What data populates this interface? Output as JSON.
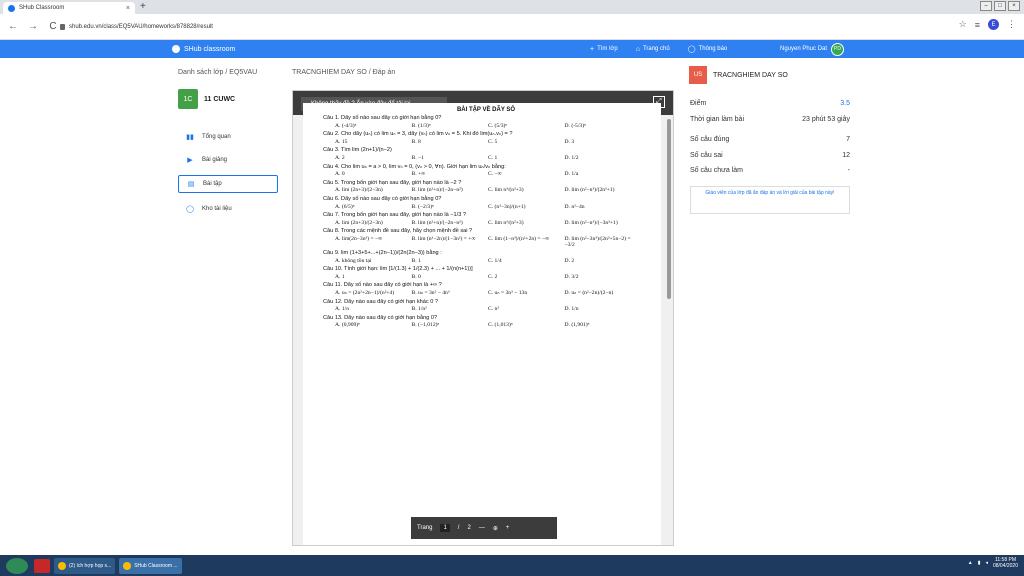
{
  "browser": {
    "tab_title": "SHub Classroom",
    "tab_close": "×",
    "new_tab": "+",
    "url": "shub.edu.vn/class/EQ5VAU/homeworks/878828/result",
    "back": "←",
    "forward": "→",
    "reload": "C",
    "star": "☆",
    "profile": "E",
    "menu": "⋮"
  },
  "app": {
    "brand": "SHub classroom",
    "nav": [
      {
        "label": "Tìm lớp",
        "icon": "+"
      },
      {
        "label": "Trang chủ",
        "icon": "⌂"
      },
      {
        "label": "Thông báo",
        "icon": "◯"
      }
    ],
    "user_name": "Nguyen Phuc Dat",
    "user_initials": "PD"
  },
  "breadcrumb_left": "Danh sách lớp / EQ5VAU",
  "breadcrumb_right": "TRACNGHIEM DAY SO / Đáp án",
  "class": {
    "code": "1C",
    "name": "11 CUWC"
  },
  "sidebar": [
    {
      "label": "Tổng quan",
      "icon": "▮▮"
    },
    {
      "label": "Bài giảng",
      "icon": "▶"
    },
    {
      "label": "Bài tập",
      "icon": "▤"
    },
    {
      "label": "Kho tài liệu",
      "icon": "◯"
    }
  ],
  "viewer": {
    "no_download": "Không thấy đề ? Ấn vào đây để tải lại",
    "open_icon": "⤢",
    "title": "BÀI TẬP VỀ DÃY SỐ",
    "pager_label": "Trang",
    "page_current": "1",
    "page_sep": "/",
    "page_total": "2",
    "zoom_out": "—",
    "zoom_icon": "⊕",
    "zoom_in": "+"
  },
  "doc": {
    "q1": "Câu 1. Dãy số nào sau đây có giới hạn bằng 0?",
    "q1_opts": [
      "A. (-4/3)ⁿ",
      "B. (1/3)ⁿ",
      "C. (5/3)ⁿ",
      "D. (-5/3)ⁿ"
    ],
    "q2": "Câu 2. Cho dãy (uₙ) có lim uₙ = 3, dãy (vₙ) có lim vₙ = 5. Khi đó lim(uₙ.vₙ) = ?",
    "q2_opts": [
      "A. 15",
      "B. 8",
      "C. 5",
      "D. 3"
    ],
    "q3": "Câu 3. Tìm lim (2n+1)/(n−2)",
    "q3_opts": [
      "A. 2",
      "B. −1",
      "C. 1",
      "D. 1/2"
    ],
    "q4": "Câu 4. Cho lim uₙ = a > 0, lim vₙ = 0, (vₙ > 0, ∀n). Giới hạn lim uₙ/vₙ bằng:",
    "q4_opts": [
      "A. 0",
      "B. +∞",
      "C. −∞",
      "D. 1/a"
    ],
    "q5": "Câu 5. Trong bốn giới hạn sau đây, giới hạn nào là −2 ?",
    "q5_opts": [
      "A. lim (2n+3)/(2−3n)",
      "B. lim (n²+n)/(−2n−n²)",
      "C. lim n³/(n²+3)",
      "D. lim (n²−n³)/(2n³+1)"
    ],
    "q6": "Câu 6. Dãy số nào sau đây có giới hạn bằng 0?",
    "q6_opts": [
      "A. (6/5)ⁿ",
      "B. (−2/3)ⁿ",
      "C. (n³−3n)/(n+1)",
      "D. n²−4n"
    ],
    "q7": "Câu 7. Trong bốn giới hạn sau đây, giới hạn nào là −1/3 ?",
    "q7_opts": [
      "A. lim (2n+3)/(2−3n)",
      "B. lim (n²+n)/(−2n−n²)",
      "C. lim n³/(n²+3)",
      "D. lim (n²−n³)/(−3n³+1)"
    ],
    "q8": "Câu 8. Trong các mệnh đề sau đây, hãy chọn mệnh đề sai ?",
    "q8_opts": [
      "A. lim(2n−3n³) = −∞",
      "B. lim (n³−2n)/(1−3n²) = +∞",
      "C. lim (1−n³)/(n²+2n) = −∞",
      "D. lim (n²−3n³)/(2n³+5n−2) = −3/2"
    ],
    "q9": "Câu 9. lim (1+3+5+...+(2n−1))/(2n(2n−3)) bằng :",
    "q9_opts": [
      "A. không tồn tại",
      "B. 1",
      "C. 1/4",
      "D. 2"
    ],
    "q10": "Câu 10. Tính giới hạn: lim [1/(1.3) + 1/(2.3) + ... + 1/(n(n+1))]",
    "q10_opts": [
      "A. 1",
      "B. 0",
      "C. 2",
      "D. 3/2"
    ],
    "q11": "Câu 11. Dãy số nào sau đây có giới hạn là +∞ ?",
    "q11_opts": [
      "A. uₙ = (2n²+2n−1)/(n²+4)",
      "B. uₙ = 3n² − 4n³",
      "C. uₙ = 3n³ − 13n",
      "D. uₙ = (n²−2n)/(2−n)"
    ],
    "q12": "Câu 12. Dãy nào sau đây có giới hạn khác 0 ?",
    "q12_opts": [
      "A. 1/n",
      "B. 1/n²",
      "C. n²",
      "D. 1/n"
    ],
    "q13": "Câu 13. Dãy nào sau đây có giới hạn bằng 0?",
    "q13_opts": [
      "A. (0,909)ⁿ",
      "B. (−1,012)ⁿ",
      "C. (1,013)ⁿ",
      "D. (1,901)ⁿ"
    ]
  },
  "result": {
    "badge": "US",
    "title": "TRACNGHIEM DAY SO",
    "rows": [
      {
        "label": "Điểm",
        "value": "3.5"
      },
      {
        "label": "Thời gian làm bài",
        "value": "23 phút 53 giây"
      },
      {
        "label": "Số câu đúng",
        "value": "7"
      },
      {
        "label": "Số câu sai",
        "value": "12"
      },
      {
        "label": "Số câu chưa làm",
        "value": "-"
      }
    ],
    "note": "Giáo viên của lớp đã ẩn đáp án và lời giải của bài tập này!"
  },
  "taskbar": {
    "btn1": "(2) ích hợp họp s...",
    "btn2": "SHub Classroom ...",
    "time": "11:58 PM",
    "date": "08/04/2020"
  }
}
